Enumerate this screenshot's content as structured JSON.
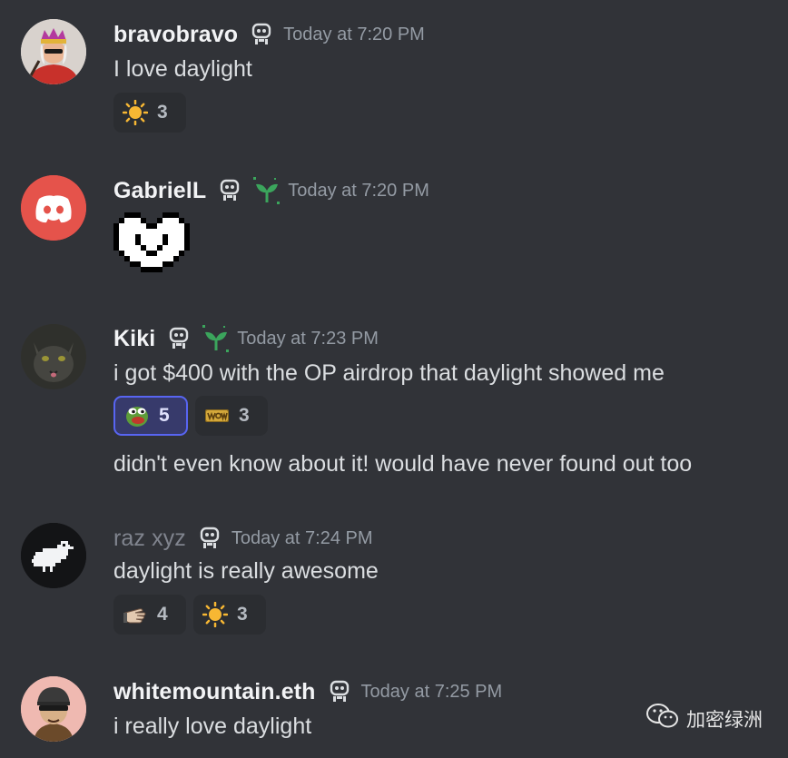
{
  "messages": [
    {
      "username": "bravobravo",
      "timestamp": "Today at 7:20 PM",
      "text": "I love daylight",
      "reactions": [
        {
          "emoji": "sun-emoji",
          "count": "3"
        }
      ]
    },
    {
      "username": "GabrielL",
      "timestamp": "Today at 7:20 PM",
      "sticker": "pixel-heart-sticker"
    },
    {
      "username": "Kiki",
      "timestamp": "Today at 7:23 PM",
      "text": "i got $400 with the OP airdrop that daylight showed me",
      "reactions": [
        {
          "emoji": "pepe-emoji",
          "count": "5",
          "active": true
        },
        {
          "emoji": "wow-emoji",
          "count": "3"
        }
      ],
      "followup_text": "didn't even know about it! would have never found out too"
    },
    {
      "username": "raz xyz",
      "timestamp": "Today at 7:24 PM",
      "text": "daylight is really awesome",
      "reactions": [
        {
          "emoji": "pointing-hand-emoji",
          "count": "4"
        },
        {
          "emoji": "sun-emoji",
          "count": "3"
        }
      ]
    },
    {
      "username": "whitemountain.eth",
      "timestamp": "Today at 7:25 PM",
      "text": "i really love daylight"
    }
  ],
  "watermark": {
    "text": "加密绿洲",
    "icon": "wechat-icon"
  },
  "colors": {
    "background": "#313338",
    "reaction_bg": "#2b2d31",
    "reaction_active_border": "#5865f2",
    "sprout_green": "#3ba55c",
    "discord_red": "#ed4245"
  }
}
